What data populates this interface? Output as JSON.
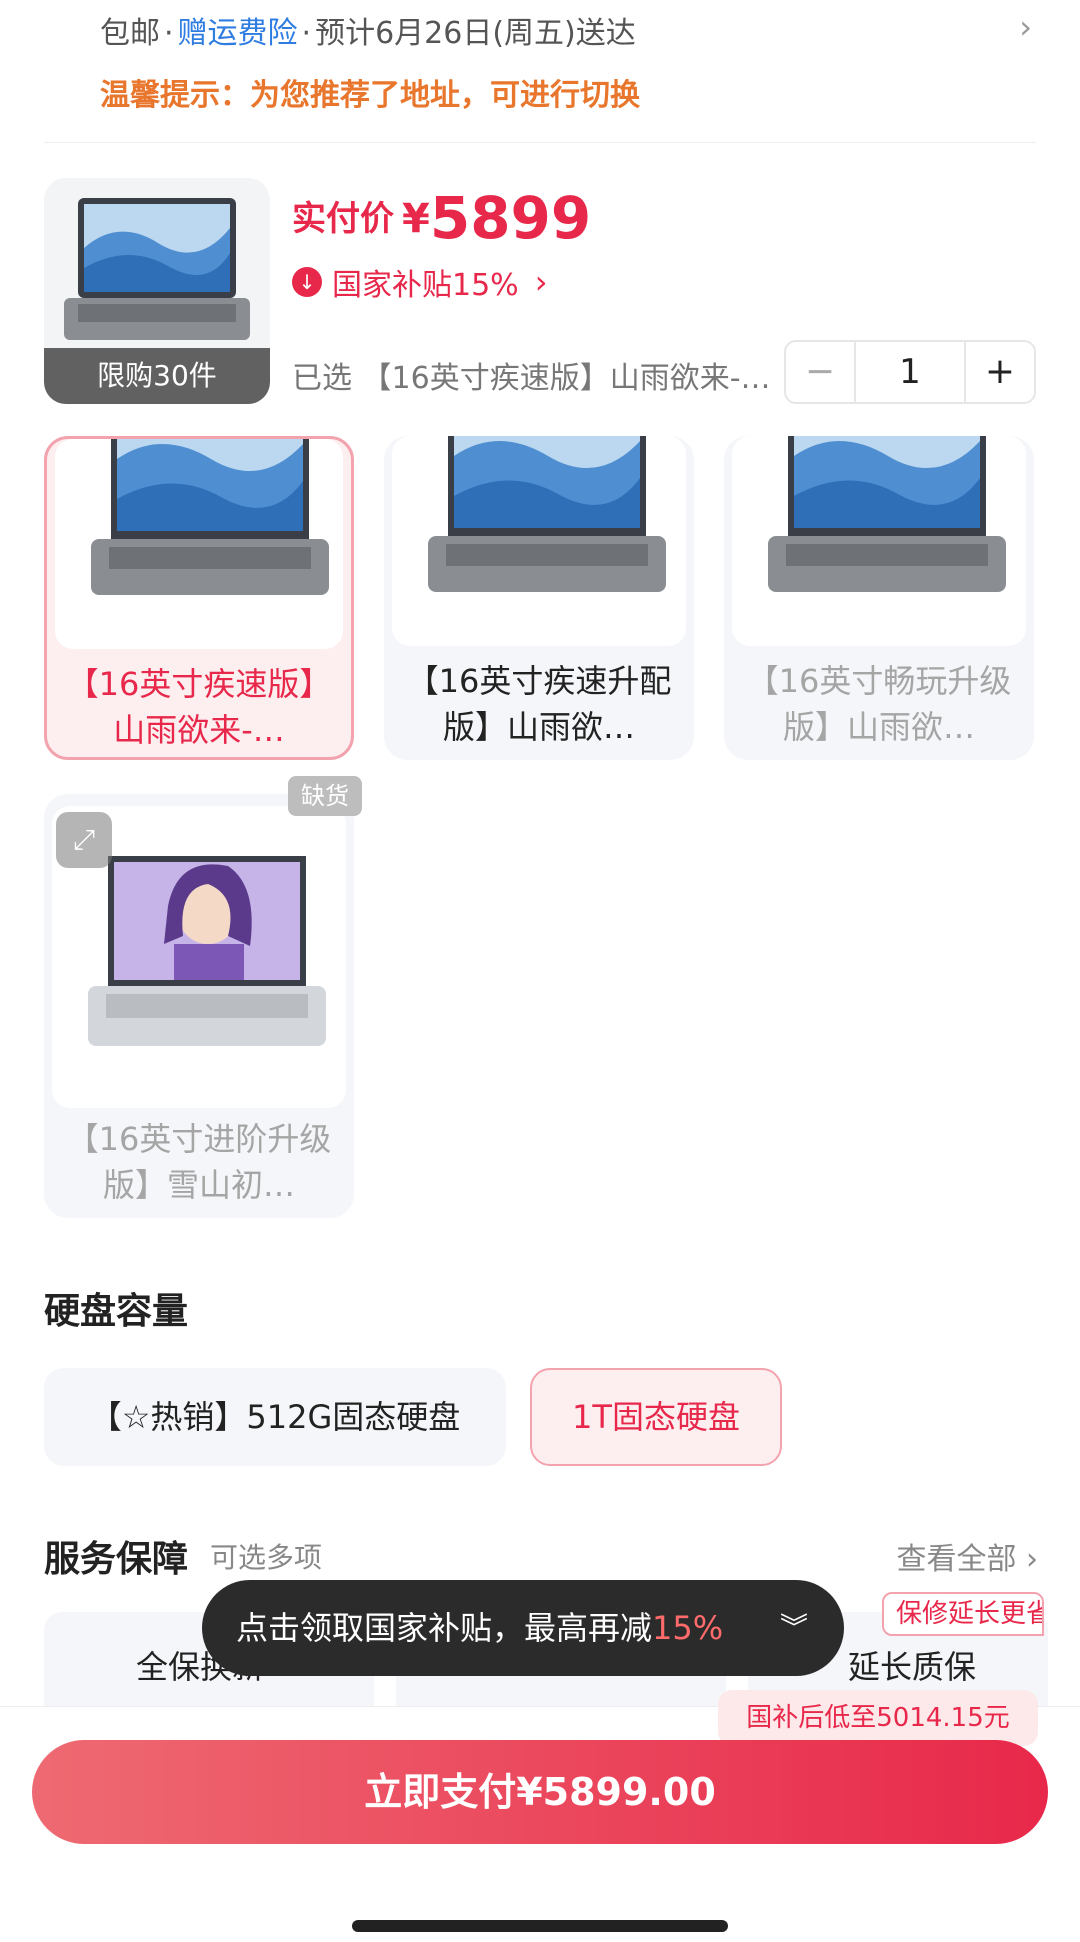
{
  "shipping": {
    "free_shipping": "包邮",
    "sep1": "·",
    "insurance": "赠运费险",
    "sep2": "·",
    "delivery": "预计6月26日(周五)送达",
    "tip": "温馨提示：为您推荐了地址，可进行切换"
  },
  "summary": {
    "limit_badge": "限购30件",
    "price_label": "实付价",
    "currency": "¥",
    "price": "5899",
    "subsidy": "国家补贴15%",
    "selected_text": "已选 【16英寸疾速版】山雨欲来-…",
    "quantity": "1",
    "minus": "−",
    "plus": "+"
  },
  "variants": [
    {
      "name": "【16英寸疾速版】山雨欲来-…",
      "state": "selected"
    },
    {
      "name": "【16英寸疾速升配版】山雨欲…",
      "state": "normal"
    },
    {
      "name": "【16英寸畅玩升级版】山雨欲…",
      "state": "dim"
    },
    {
      "name": "【16英寸进阶升级版】雪山初…",
      "state": "dim",
      "badge": "缺货"
    }
  ],
  "storage": {
    "title": "硬盘容量",
    "options": [
      "【☆热销】512G固态硬盘",
      "1T固态硬盘"
    ]
  },
  "service": {
    "title": "服务保障",
    "subtitle": "可选多项",
    "view_all": "查看全部",
    "items": [
      "全保换新",
      "延长质保"
    ],
    "tag": "保修延长更省"
  },
  "toast": {
    "text": "点击领取国家补贴，最高再减",
    "pct": "15%"
  },
  "bottom": {
    "low_price": "国补后低至5014.15元",
    "pay": "立即支付¥5899.00"
  },
  "colors": {
    "accent": "#e8284a",
    "tip_orange": "#e8762c",
    "link_blue": "#2f7de1"
  }
}
